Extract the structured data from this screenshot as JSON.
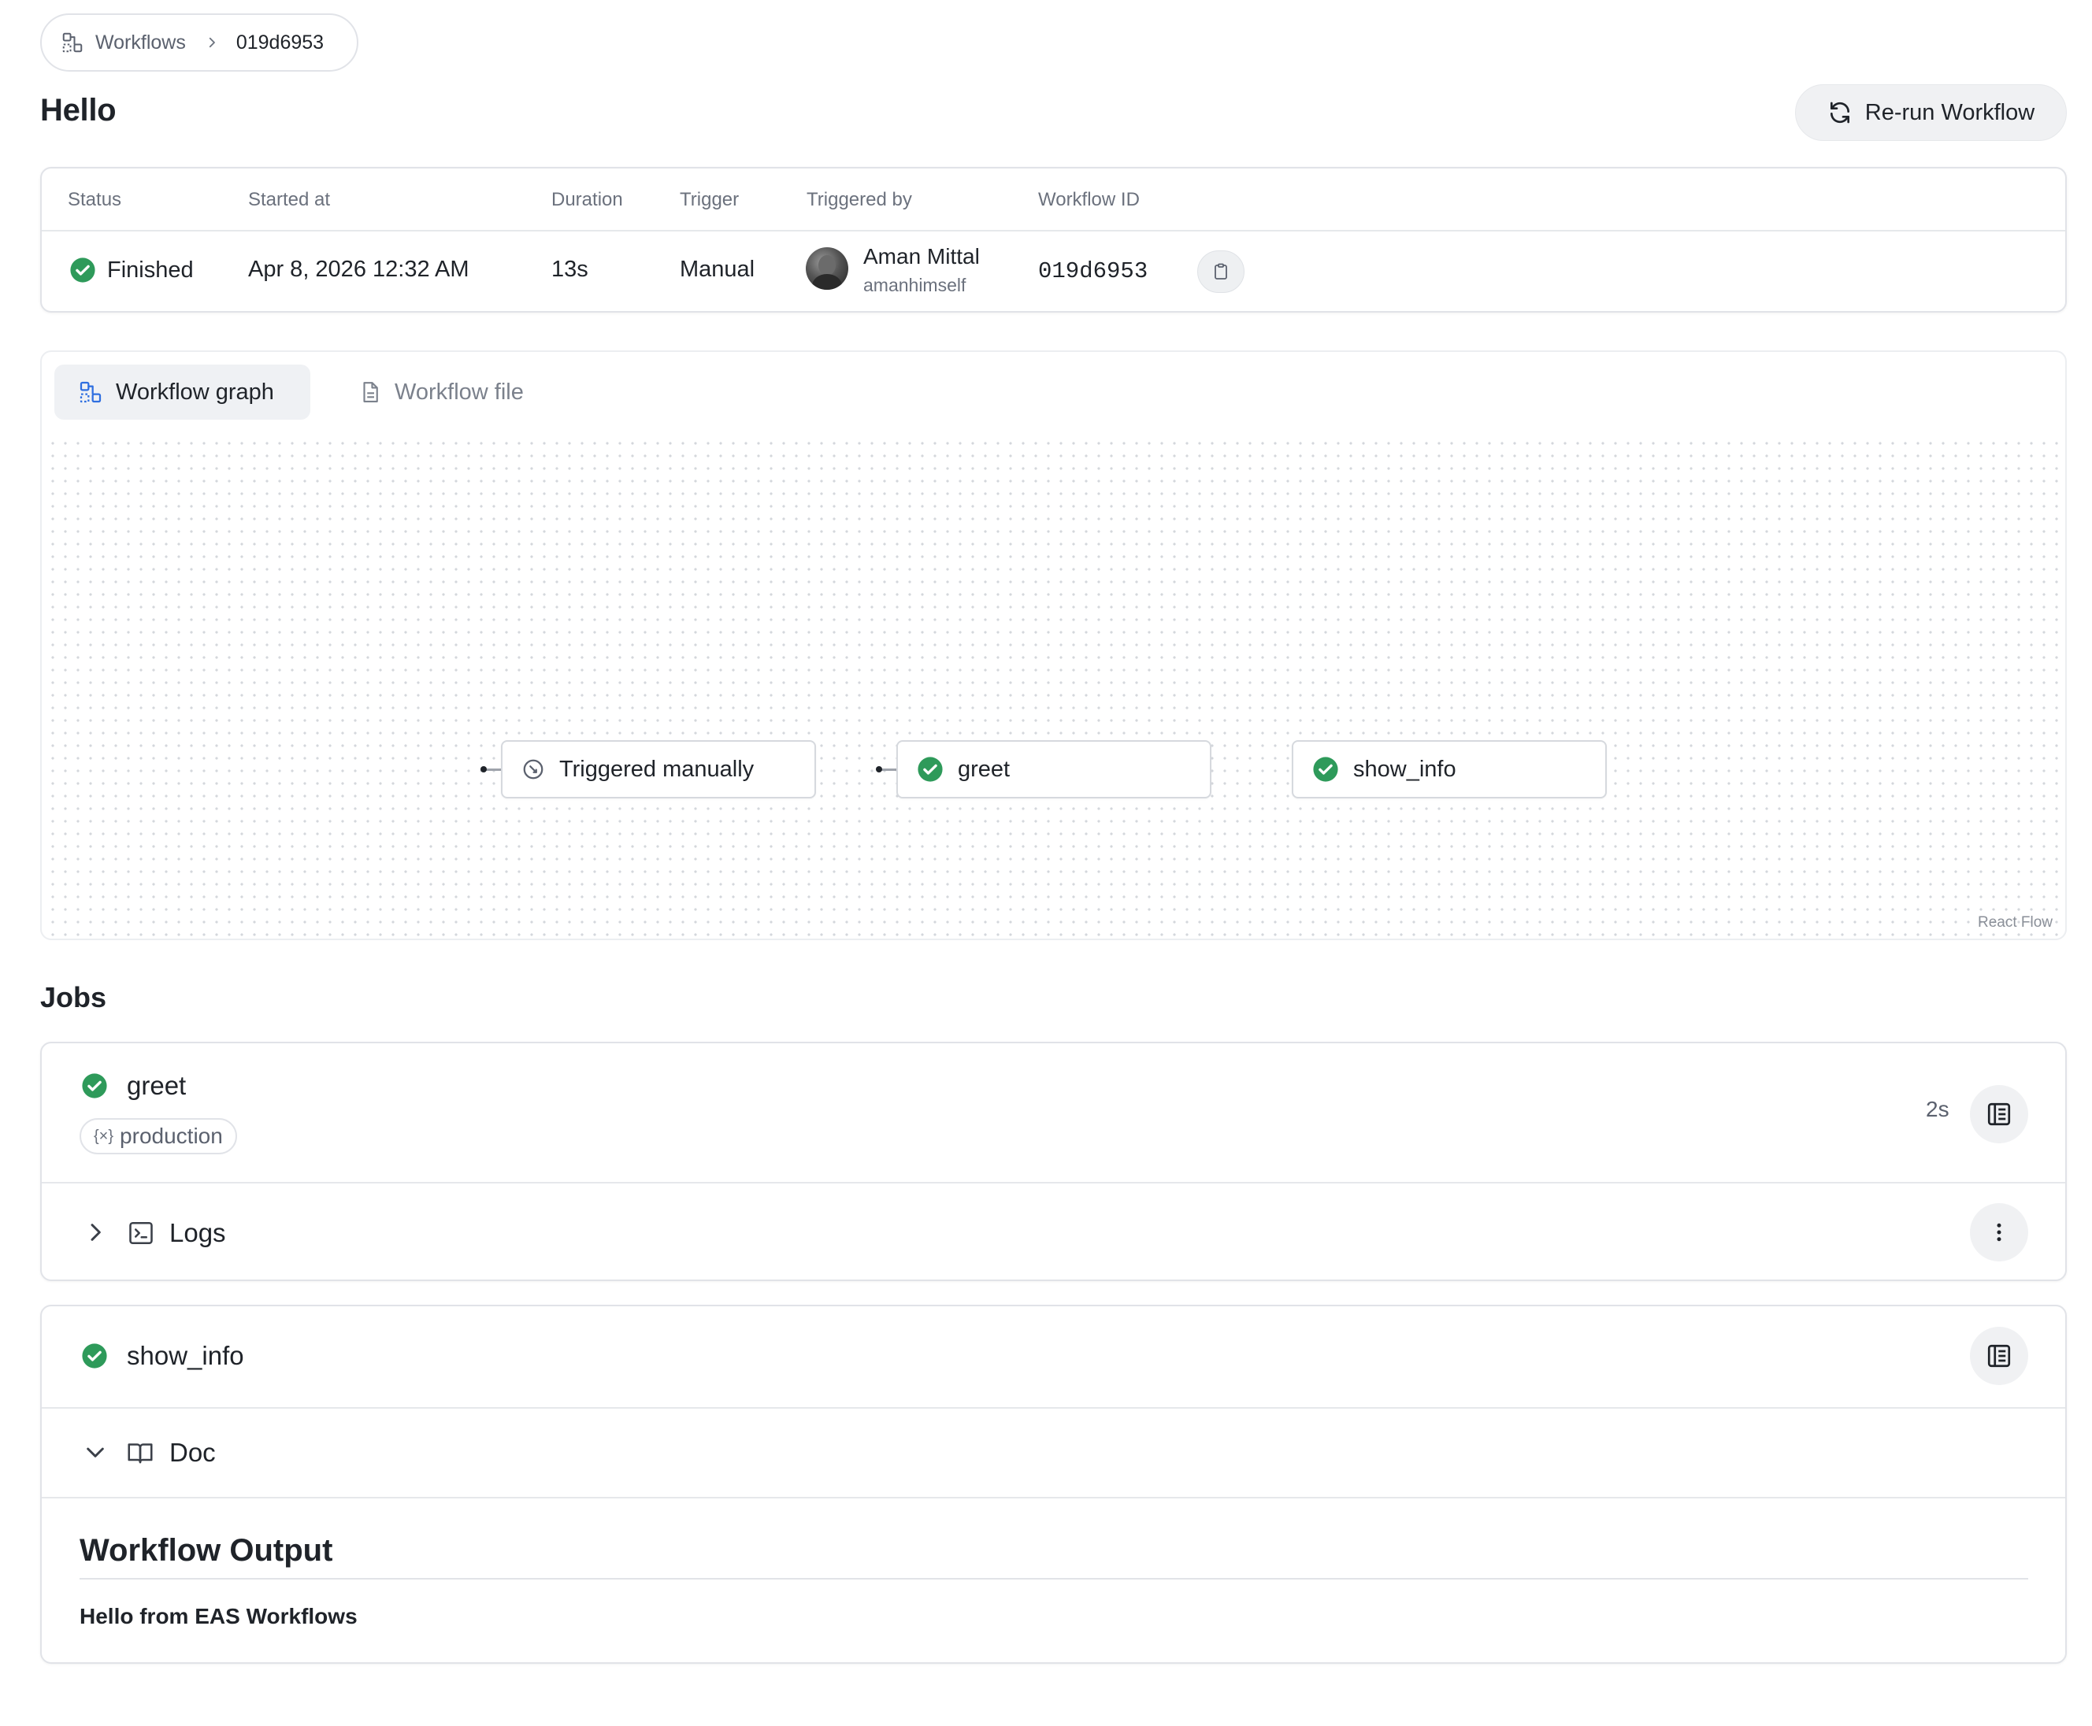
{
  "breadcrumb": {
    "workflows_label": "Workflows",
    "current": "019d6953",
    "icon": "workflow-icon"
  },
  "header": {
    "title": "Hello",
    "rerun_label": "Re-run Workflow",
    "rerun_icon": "refresh-icon"
  },
  "summary": {
    "columns": [
      "Status",
      "Started at",
      "Duration",
      "Trigger",
      "Triggered by",
      "Workflow ID"
    ],
    "status": "Finished",
    "started_at": "Apr 8, 2026 12:32 AM",
    "duration": "13s",
    "trigger": "Manual",
    "triggered_by_name": "Aman Mittal",
    "triggered_by_username": "amanhimself",
    "workflow_id": "019d6953"
  },
  "tabs": [
    {
      "label": "Workflow graph",
      "icon": "workflow-icon",
      "active": true
    },
    {
      "label": "Workflow file",
      "icon": "file-icon",
      "active": false
    }
  ],
  "graph": {
    "nodes": [
      {
        "label": "Triggered manually",
        "icon": "manual-trigger-icon"
      },
      {
        "label": "greet",
        "icon": "check-circle-icon"
      },
      {
        "label": "show_info",
        "icon": "check-circle-icon"
      }
    ],
    "attribution": "React Flow"
  },
  "jobs": {
    "title": "Jobs",
    "items": [
      {
        "name": "greet",
        "environment": "production",
        "duration": "2s",
        "section_label": "Logs",
        "section_expanded": false
      },
      {
        "name": "show_info",
        "section_label": "Doc",
        "section_expanded": true,
        "output_title": "Workflow Output",
        "output_text": "Hello from EAS Workflows"
      }
    ]
  },
  "colors": {
    "success": "#2e9a5a",
    "accent": "#2f6fe0",
    "border": "#e1e3e8"
  }
}
